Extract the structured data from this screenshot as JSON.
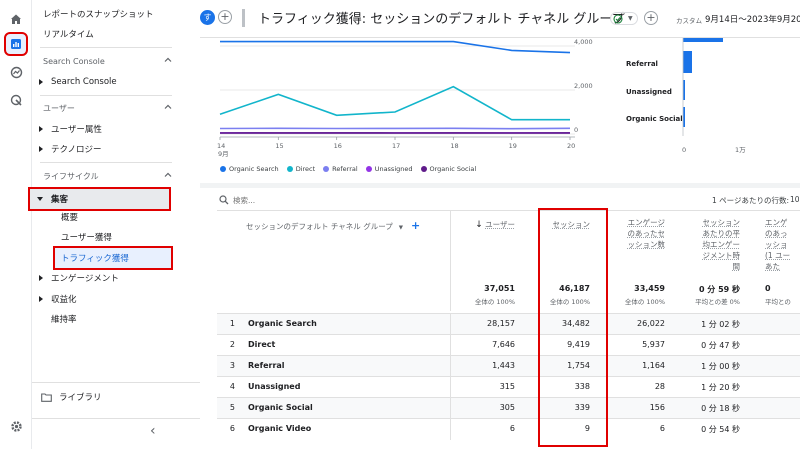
{
  "sidebar": {
    "snapshot": "レポートのスナップショット",
    "realtime": "リアルタイム",
    "sec_search_console": "Search Console",
    "search_console": "Search Console",
    "sec_user": "ユーザー",
    "user_attr": "ユーザー属性",
    "technology": "テクノロジー",
    "sec_lifecycle": "ライフサイクル",
    "acquisition": "集客",
    "overview": "概要",
    "user_acq": "ユーザー獲得",
    "traffic_acq": "トラフィック獲得",
    "engagement": "エンゲージメント",
    "monetization": "収益化",
    "retention": "維持率",
    "library": "ライブラリ",
    "collapse_icon": "‹"
  },
  "header": {
    "avatar": "す",
    "title": "トラフィック獲得: セッションのデフォルト チャネル グループ",
    "date_label": "カスタム",
    "date_range": "9月14日～2023年9月20日"
  },
  "line_chart": {
    "y_ticks": [
      "4,000",
      "2,000",
      "0"
    ],
    "x_ticks": [
      "14",
      "15",
      "16",
      "17",
      "18",
      "19",
      "20"
    ],
    "month": "9月",
    "legend": [
      "Organic Search",
      "Direct",
      "Referral",
      "Unassigned",
      "Organic Social"
    ]
  },
  "bar_chart": {
    "categories": [
      "Direct",
      "Referral",
      "Unassigned",
      "Organic Social"
    ],
    "x_ticks": [
      "0",
      "1万",
      "2万"
    ]
  },
  "table": {
    "search_placeholder": "検索...",
    "rows_per_page": "1 ページあたりの行数:",
    "rows_per_page_val": "10",
    "dimension_header": "セッションのデフォルト チャネル グループ",
    "col_users": "ユーザー",
    "col_sessions": "セッション",
    "col_engaged": [
      "エンゲージ",
      "のあったセ",
      "ッション数"
    ],
    "col_avg": [
      "セッション",
      "あたりの平",
      "均エンゲー",
      "ジメント時",
      "間"
    ],
    "col_eng_per": [
      "エンゲ",
      "のあっ",
      "ッショ",
      "(1 ユー",
      "あた"
    ],
    "totals": {
      "users": "37,051",
      "users_pct": "全体の 100%",
      "sessions": "46,187",
      "sessions_pct": "全体の 100%",
      "engaged": "33,459",
      "engaged_pct": "全体の 100%",
      "avg": "0 分 59 秒",
      "avg_pct": "平均との差 0%",
      "eng_per": "平均との",
      "last": "0"
    },
    "rows": [
      {
        "idx": "1",
        "name": "Organic Search",
        "users": "28,157",
        "sessions": "34,482",
        "engaged": "26,022",
        "avg": "1 分 02 秒"
      },
      {
        "idx": "2",
        "name": "Direct",
        "users": "7,646",
        "sessions": "9,419",
        "engaged": "5,937",
        "avg": "0 分 47 秒"
      },
      {
        "idx": "3",
        "name": "Referral",
        "users": "1,443",
        "sessions": "1,754",
        "engaged": "1,164",
        "avg": "1 分 00 秒"
      },
      {
        "idx": "4",
        "name": "Unassigned",
        "users": "315",
        "sessions": "338",
        "engaged": "28",
        "avg": "1 分 20 秒"
      },
      {
        "idx": "5",
        "name": "Organic Social",
        "users": "305",
        "sessions": "339",
        "engaged": "156",
        "avg": "0 分 18 秒"
      },
      {
        "idx": "6",
        "name": "Organic Video",
        "users": "6",
        "sessions": "9",
        "engaged": "6",
        "avg": "0 分 54 秒"
      }
    ]
  },
  "chart_data": {
    "type": "line",
    "x": [
      "14",
      "15",
      "16",
      "17",
      "18",
      "19",
      "20"
    ],
    "ylim": [
      0,
      4000
    ],
    "series": [
      {
        "name": "Organic Search",
        "values": [
          4200,
          4200,
          4200,
          4200,
          4200,
          3800,
          3700
        ]
      },
      {
        "name": "Direct",
        "values": [
          900,
          1800,
          850,
          1000,
          2150,
          650,
          650
        ]
      },
      {
        "name": "Referral",
        "values": [
          250,
          260,
          250,
          255,
          260,
          240,
          260
        ]
      },
      {
        "name": "Unassigned",
        "values": [
          50,
          45,
          50,
          48,
          50,
          47,
          50
        ]
      },
      {
        "name": "Organic Social",
        "values": [
          45,
          50,
          48,
          46,
          50,
          45,
          47
        ]
      }
    ]
  },
  "colors": {
    "accent": "#1a73e8",
    "highlight": "#e00000",
    "series": [
      "#1a73e8",
      "#12b5cb",
      "#7b7ff0",
      "#9334e6",
      "#5f1b8a"
    ]
  }
}
